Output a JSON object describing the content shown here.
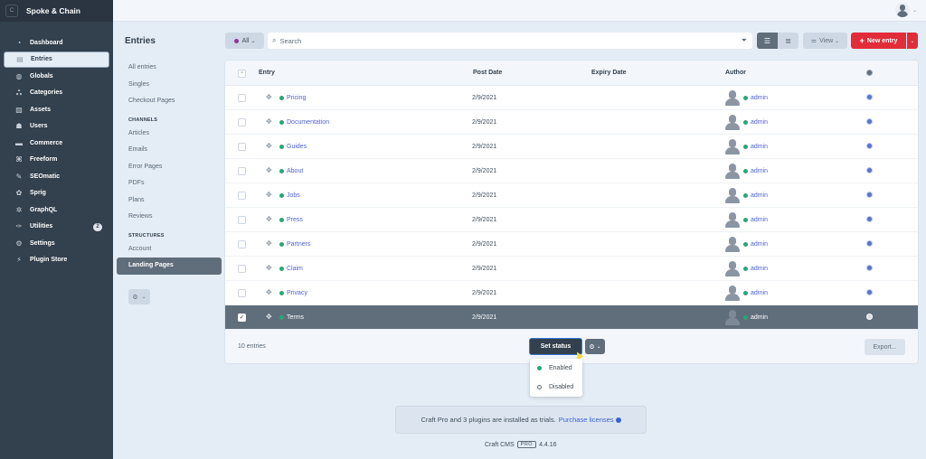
{
  "site": {
    "icon_letter": "C",
    "name": "Spoke & Chain"
  },
  "nav": [
    {
      "label": "Dashboard",
      "icon": "gauge-icon",
      "glyph": "◔",
      "active": false
    },
    {
      "label": "Entries",
      "icon": "newspaper-icon",
      "glyph": "▤",
      "active": true
    },
    {
      "label": "Globals",
      "icon": "globe-icon",
      "glyph": "◍",
      "active": false
    },
    {
      "label": "Categories",
      "icon": "sitemap-icon",
      "glyph": "ஃ",
      "active": false
    },
    {
      "label": "Assets",
      "icon": "image-icon",
      "glyph": "▨",
      "active": false
    },
    {
      "label": "Users",
      "icon": "users-icon",
      "glyph": "☗",
      "active": false
    },
    {
      "label": "Commerce",
      "icon": "credit-card-icon",
      "glyph": "▬",
      "active": false
    },
    {
      "label": "Freeform",
      "icon": "freeform-icon",
      "glyph": "⌘",
      "active": false
    },
    {
      "label": "SEOmatic",
      "icon": "seomatic-icon",
      "glyph": "✎",
      "active": false
    },
    {
      "label": "Sprig",
      "icon": "sprig-icon",
      "glyph": "✿",
      "active": false
    },
    {
      "label": "GraphQL",
      "icon": "graphql-icon",
      "glyph": "✲",
      "active": false
    },
    {
      "label": "Utilities",
      "icon": "wrench-icon",
      "glyph": "✑",
      "active": false,
      "badge": "2"
    },
    {
      "label": "Settings",
      "icon": "gear-icon",
      "glyph": "⚙",
      "active": false
    },
    {
      "label": "Plugin Store",
      "icon": "plug-icon",
      "glyph": "⚡",
      "active": false
    }
  ],
  "page_title": "Entries",
  "sources": {
    "top": [
      "All entries",
      "Singles",
      "Checkout Pages"
    ],
    "channels_heading": "CHANNELS",
    "channels": [
      "Articles",
      "Emails",
      "Error Pages",
      "PDFs",
      "Plans",
      "Reviews"
    ],
    "structures_heading": "STRUCTURES",
    "structures": [
      "Account",
      "Landing Pages"
    ],
    "selected": "Landing Pages"
  },
  "toolbar": {
    "status_filter": "All",
    "status_color": "#8c36a0",
    "search_placeholder": "Search",
    "view_label": "View",
    "new_entry_label": "New entry"
  },
  "table": {
    "headers": {
      "entry": "Entry",
      "post_date": "Post Date",
      "expiry_date": "Expiry Date",
      "author": "Author"
    },
    "rows": [
      {
        "title": "Pricing",
        "post_date": "2/9/2021",
        "expiry_date": "",
        "author": "admin",
        "status": "enabled",
        "selected": false
      },
      {
        "title": "Documentation",
        "post_date": "2/9/2021",
        "expiry_date": "",
        "author": "admin",
        "status": "enabled",
        "selected": false
      },
      {
        "title": "Guides",
        "post_date": "2/9/2021",
        "expiry_date": "",
        "author": "admin",
        "status": "enabled",
        "selected": false
      },
      {
        "title": "About",
        "post_date": "2/9/2021",
        "expiry_date": "",
        "author": "admin",
        "status": "enabled",
        "selected": false
      },
      {
        "title": "Jobs",
        "post_date": "2/9/2021",
        "expiry_date": "",
        "author": "admin",
        "status": "enabled",
        "selected": false
      },
      {
        "title": "Press",
        "post_date": "2/9/2021",
        "expiry_date": "",
        "author": "admin",
        "status": "enabled",
        "selected": false
      },
      {
        "title": "Partners",
        "post_date": "2/9/2021",
        "expiry_date": "",
        "author": "admin",
        "status": "enabled",
        "selected": false
      },
      {
        "title": "Claim",
        "post_date": "2/9/2021",
        "expiry_date": "",
        "author": "admin",
        "status": "enabled",
        "selected": false
      },
      {
        "title": "Privacy",
        "post_date": "2/9/2021",
        "expiry_date": "",
        "author": "admin",
        "status": "enabled",
        "selected": false
      },
      {
        "title": "Terms",
        "post_date": "2/9/2021",
        "expiry_date": "",
        "author": "admin",
        "status": "enabled",
        "selected": true
      }
    ],
    "count_label": "10 entries",
    "set_status_label": "Set status",
    "export_label": "Export..."
  },
  "status_menu": {
    "items": [
      {
        "label": "Enabled",
        "kind": "enabled"
      },
      {
        "label": "Disabled",
        "kind": "disabled"
      }
    ]
  },
  "trial_notice": {
    "text": "Craft Pro and 3 plugins are installed as trials.",
    "link": "Purchase licenses"
  },
  "footer": {
    "product": "Craft CMS",
    "edition": "PRO",
    "version": "4.4.16"
  }
}
